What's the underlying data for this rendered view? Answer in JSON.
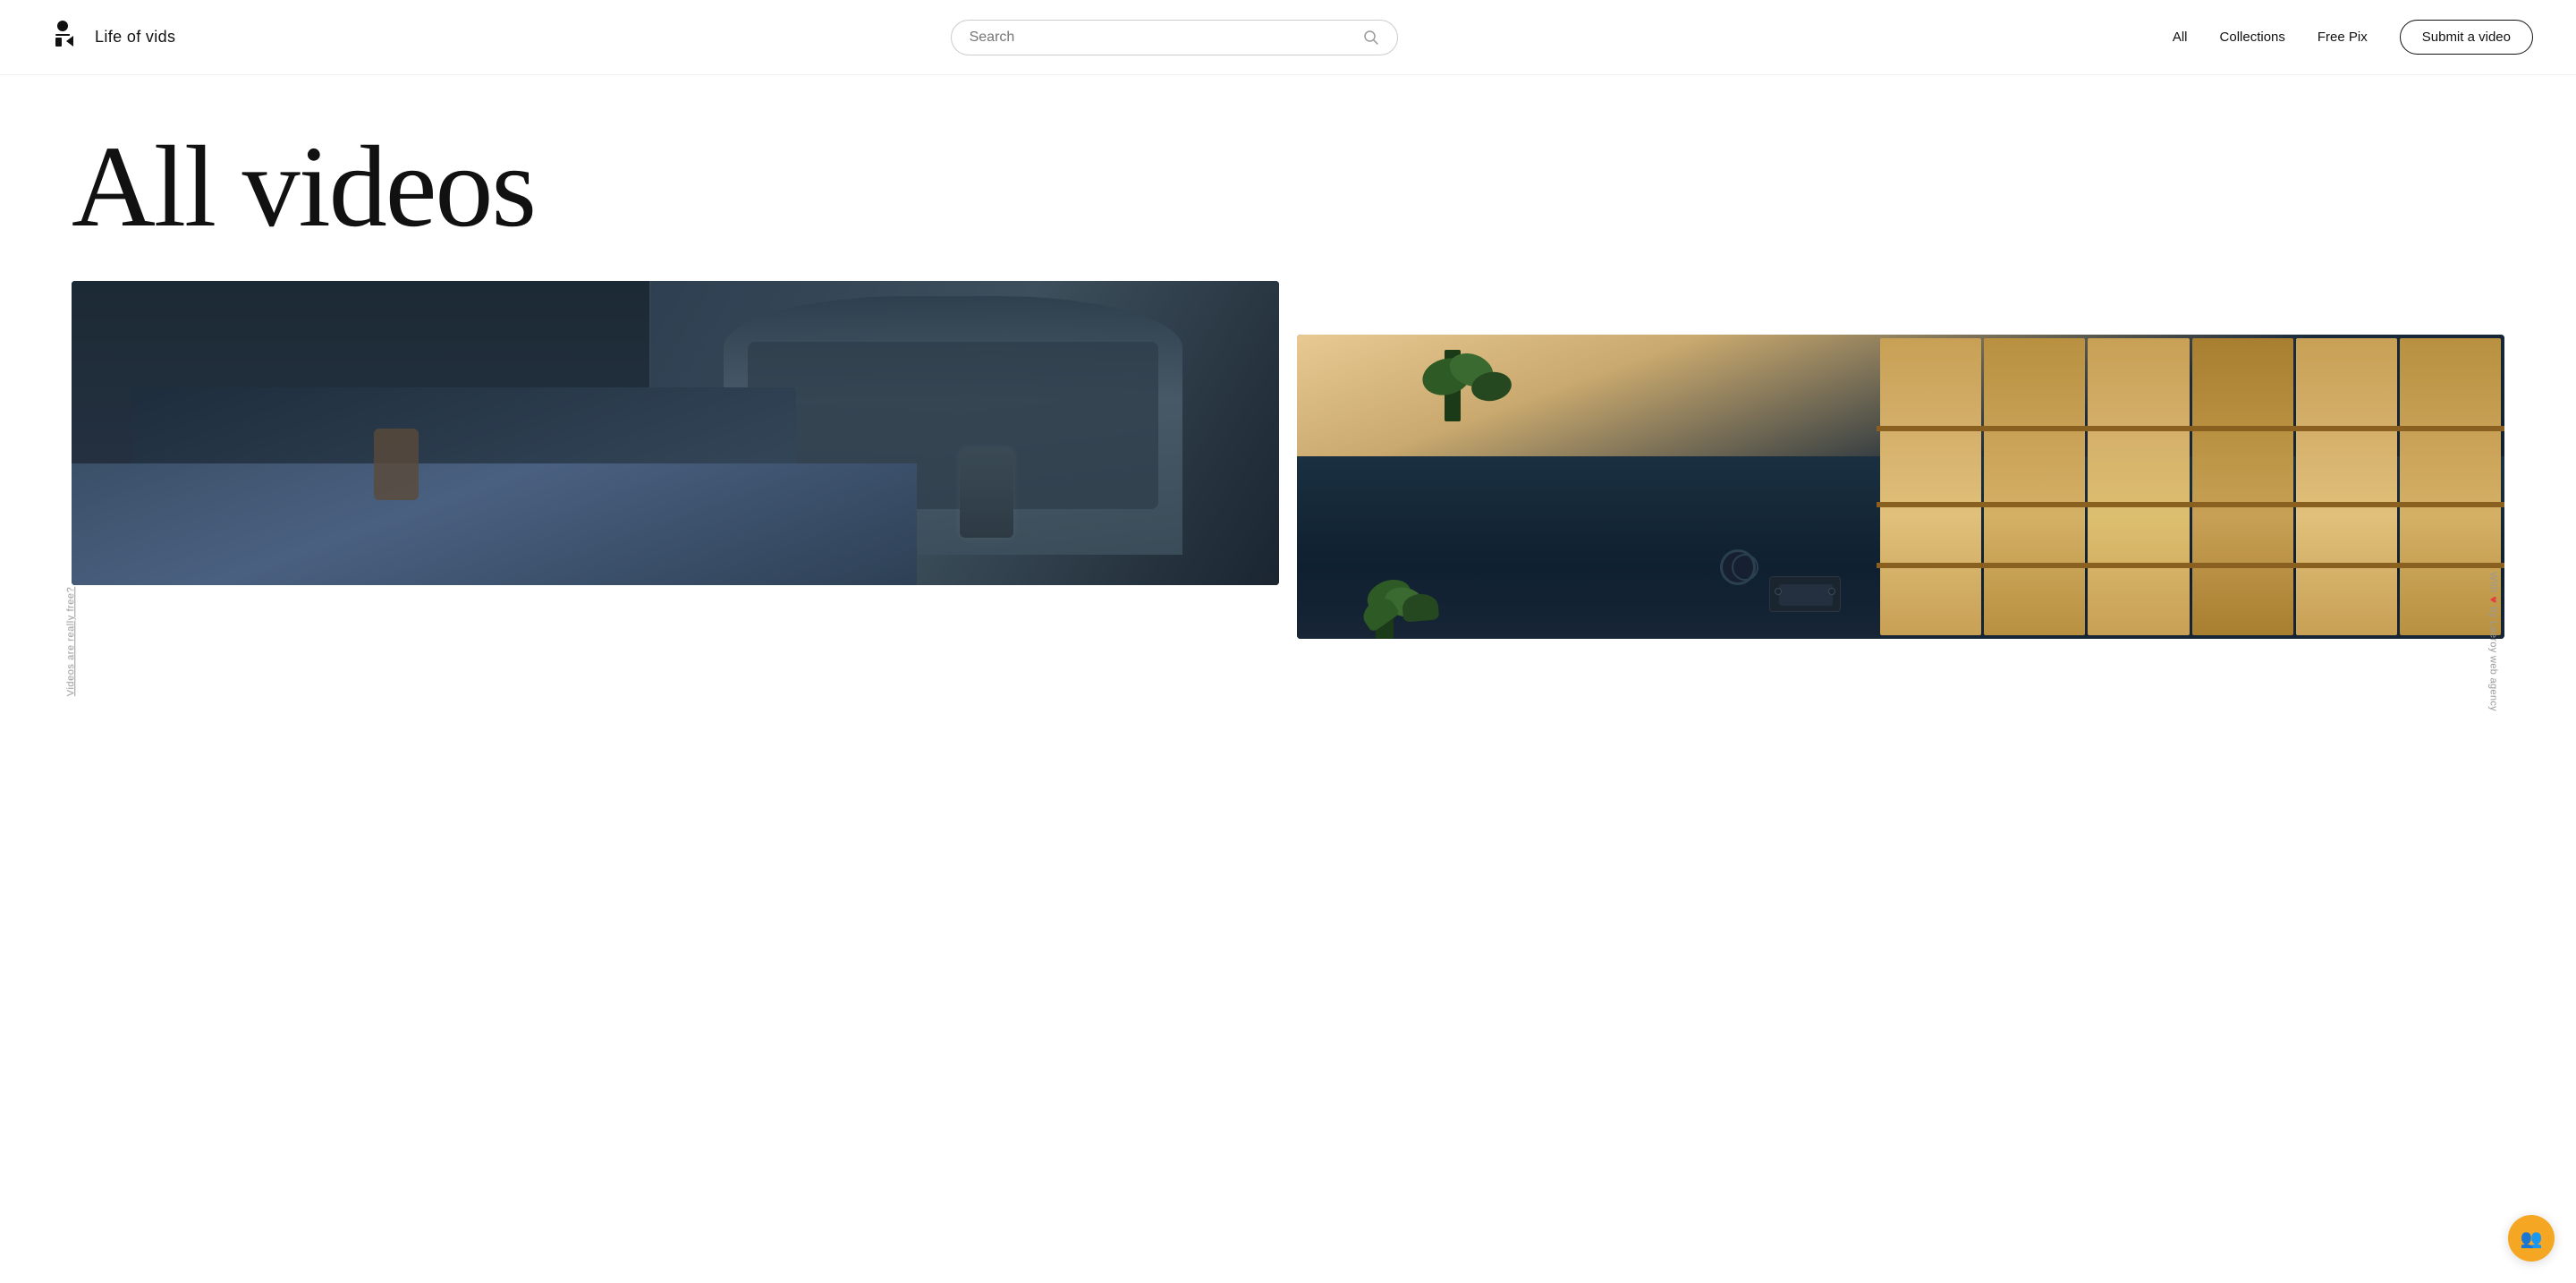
{
  "header": {
    "logo_icon_alt": "life-of-vids-logo",
    "logo_text": "Life of vids",
    "search_placeholder": "Search",
    "nav": {
      "all": "All",
      "collections": "Collections",
      "free_pix": "Free Pix",
      "submit_button": "Submit a video"
    }
  },
  "side_labels": {
    "left": "Videos are really free?",
    "right_prefix": "With",
    "right_suffix": "by Leeroy web agency"
  },
  "hero": {
    "title_dark": "All",
    "title_light": " videos"
  },
  "videos": [
    {
      "id": "video-1",
      "description": "People using laptops and phones in a waiting area",
      "alt": "People with technology"
    },
    {
      "id": "video-2",
      "description": "Overhead view of wooden architecture with drone and plants",
      "alt": "Wooden architecture overhead"
    }
  ],
  "chat_widget": {
    "label": "Chat"
  }
}
